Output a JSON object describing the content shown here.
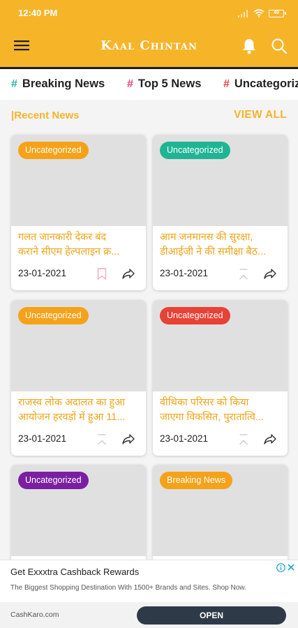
{
  "status_bar": {
    "time": "12:40 PM",
    "battery": "49"
  },
  "app": {
    "title": "Kaal Chintan"
  },
  "categories": [
    {
      "label": "Breaking News",
      "hash": "#",
      "hash_color": "#1fb5a0"
    },
    {
      "label": "Top 5 News",
      "hash": "#",
      "hash_color": "#ec3f73"
    },
    {
      "label": "Uncategorized",
      "hash": "#",
      "hash_color": "#e94040"
    }
  ],
  "recent": {
    "title": "|Recent News",
    "view_all": "VIEW ALL"
  },
  "cards": [
    {
      "badge": "Uncategorized",
      "badge_color": "#f5a219",
      "title_line1": "गलत जानकारी देकर बंद",
      "title_line2": "कराने सीएम हेल्पलाइन क्र...",
      "date": "23-01-2021",
      "bookmark_icon": "bookmark-outline-pink"
    },
    {
      "badge": "Uncategorized",
      "badge_color": "#1fb594",
      "title_line1": "आम जनमानस की सुरक्षा,",
      "title_line2": "डीआईजी ने की समीक्षा बैठ...",
      "date": "23-01-2021",
      "bookmark_icon": "bookmark-outline-grey"
    },
    {
      "badge": "Uncategorized",
      "badge_color": "#f5a219",
      "title_line1": "राजस्व लोक अदालत का हुआ",
      "title_line2": "आयोजन हरवड़ों में हुआ 11...",
      "date": "23-01-2021",
      "bookmark_icon": "bookmark-outline-grey"
    },
    {
      "badge": "Uncategorized",
      "badge_color": "#e84136",
      "title_line1": "वीथिका परिसर को किया",
      "title_line2": "जाएगा विकसित, पुरातात्वि...",
      "date": "23-01-2021",
      "bookmark_icon": "bookmark-outline-grey"
    },
    {
      "badge": "Uncategorized",
      "badge_color": "#7b1fa2",
      "title_line1": "",
      "title_line2": "",
      "date": "",
      "bookmark_icon": ""
    },
    {
      "badge": "Breaking News",
      "badge_color": "#f5a219",
      "title_line1": "",
      "title_line2": "",
      "date": "",
      "bookmark_icon": ""
    }
  ],
  "ad": {
    "title": "Get Exxxtra Cashback Rewards",
    "subtitle": "The Biggest Shopping Destination With 1500+ Brands and Sites. Shop Now.",
    "domain": "CashKaro.com",
    "cta": "OPEN"
  },
  "colors": {
    "primary": "#f6b429",
    "card_title": "#f0a419"
  }
}
